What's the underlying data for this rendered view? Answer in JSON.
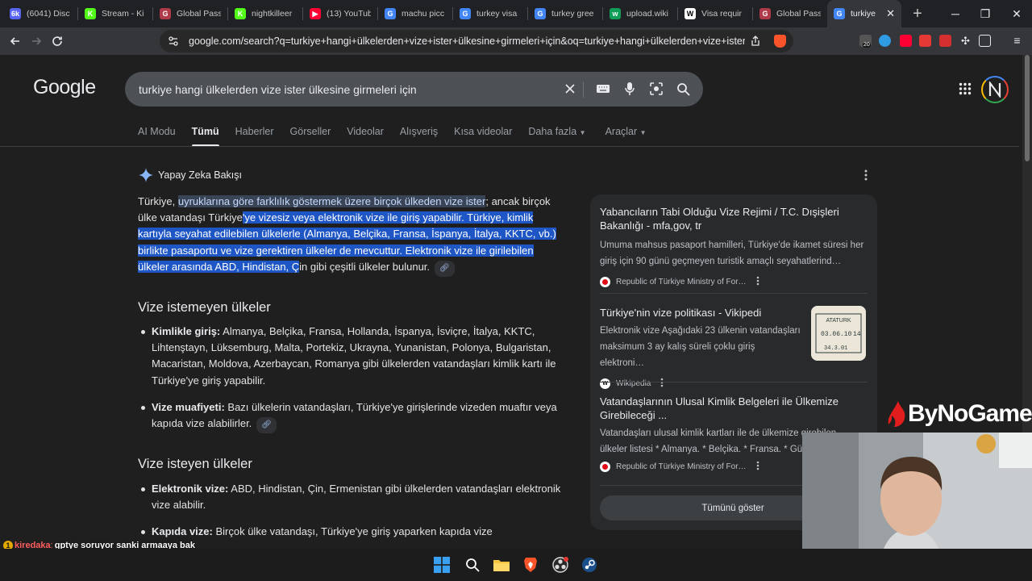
{
  "tabs": [
    {
      "title": "(6041) Disc",
      "color": "#5865f2",
      "glyph": "6k"
    },
    {
      "title": "Stream - Ki",
      "color": "#53fc18",
      "glyph": "K"
    },
    {
      "title": "Global Pass",
      "color": "#b03a48",
      "glyph": "G"
    },
    {
      "title": "nightkilleer",
      "color": "#53fc18",
      "glyph": "K"
    },
    {
      "title": "(13) YouTub",
      "color": "#ff0033",
      "glyph": "▶"
    },
    {
      "title": "machu picc",
      "color": "#4285f4",
      "glyph": "G"
    },
    {
      "title": "turkey visa",
      "color": "#4285f4",
      "glyph": "G"
    },
    {
      "title": "turkey gree",
      "color": "#4285f4",
      "glyph": "G"
    },
    {
      "title": "upload.wiki",
      "color": "#0f9d58",
      "glyph": "w"
    },
    {
      "title": "Visa requir",
      "color": "#ffffff",
      "glyph": "W"
    },
    {
      "title": "Global Pass",
      "color": "#b03a48",
      "glyph": "G"
    },
    {
      "title": "turkiye",
      "color": "#4285f4",
      "glyph": "G",
      "active": true
    }
  ],
  "window": {
    "minimize": "─",
    "maximize": "❐",
    "close": "✕",
    "new_tab": "+"
  },
  "toolbar": {
    "url": "google.com/search?q=turkiye+hangi+ülkelerden+vize+ister+ülkesine+girmeleri+için&oq=turkiye+hangi+ülkelerden+vize+ister+ül...",
    "badge_count": "20"
  },
  "search": {
    "logo": "Google",
    "query": "turkiye hangi ülkelerden vize ister ülkesine girmeleri için"
  },
  "nav_tabs": [
    "AI Modu",
    "Tümü",
    "Haberler",
    "Görseller",
    "Videolar",
    "Alışveriş",
    "Kısa videolar",
    "Daha fazla",
    "Araçlar"
  ],
  "ai_overview": {
    "heading": "Yapay Zeka Bakışı",
    "p_plain1": "Türkiye, ",
    "p_hl1": "uyruklarına göre farklılık göstermek üzere birçok ülkeden vize ister",
    "p_plain2": "; ancak birçok ülke vatandaşı Türkiye",
    "p_hl2": "'ye vizesiz veya elektronik vize ile giriş yapabilir. Türkiye, kimlik kartıyla seyahat edilebilen ülkelerle (Almanya, Belçika, Fransa, İspanya, İtalya, KKTC, vb.) birlikte pasaportu ve vize gerektiren ülkeler de mevcuttur. Elektronik vize ile girilebilen ülkeler arasında ABD, Hindistan, Ç",
    "p_plain3": "in gibi çeşitli ülkeler bulunur.",
    "section1_title": "Vize istemeyen ülkeler",
    "section1_items": [
      {
        "bold": "Kimlikle giriş:",
        "text": " Almanya, Belçika, Fransa, Hollanda, İspanya, İsviçre, İtalya, KKTC, Lihtenştayn, Lüksemburg, Malta, Portekiz, Ukrayna, Yunanistan, Polonya, Bulgaristan, Macaristan, Moldova, Azerbaycan, Romanya gibi ülkelerden vatandaşları kimlik kartı ile Türkiye'ye giriş yapabilir."
      },
      {
        "bold": "Vize muafiyeti:",
        "text": " Bazı ülkelerin vatandaşları, Türkiye'ye girişlerinde vizeden muaftır veya kapıda vize alabilirler."
      }
    ],
    "section2_title": "Vize isteyen ülkeler",
    "section2_items": [
      {
        "bold": "Elektronik vize:",
        "text": " ABD, Hindistan, Çin, Ermenistan gibi ülkelerden vatandaşları elektronik vize alabilir."
      },
      {
        "bold": "Kapıda vize:",
        "text": " Birçok ülke vatandaşı, Türkiye'ye giriş yaparken kapıda vize"
      }
    ]
  },
  "sources": [
    {
      "title": "Yabancıların Tabi Olduğu Vize Rejimi / T.C. Dışişleri Bakanlığı - mfa,gov, tr",
      "snippet": "Umuma mahsus pasaport hamilleri, Türkiye'de ikamet süresi her giriş için 90 günü geçmeyen turistik amaçlı seyahatlerind…",
      "site": "Republic of Türkiye Ministry of For…"
    },
    {
      "title": "Türkiye'nin vize politikası - Vikipedi",
      "snippet": "Elektronik vize Aşağıdaki 23 ülkenin vatandaşları maksimum 3 ay kalış süreli çoklu giriş elektroni…",
      "site": "Wikipedia"
    },
    {
      "title": "Vatandaşlarının Ulusal Kimlik Belgeleri ile Ülkemize Girebileceği ...",
      "snippet": "Vatandaşları ulusal kimlik kartları ile de ülkemize girebilen ülkeler listesi * Almanya. * Belçika. * Fransa. * Gü…",
      "site": "Republic of Türkiye Ministry of For…"
    }
  ],
  "show_all": "Tümünü göster",
  "stamp_text": {
    "line1": "ATATURK",
    "date": "03.06.10",
    "num": "14",
    "line3": "34.3.01"
  },
  "overlay": {
    "brand": "ByNoGame",
    "chat_user": "kiredaka",
    "chat_badge": "1",
    "chat_message": "gptye soruyor sanki armaaya bak"
  }
}
